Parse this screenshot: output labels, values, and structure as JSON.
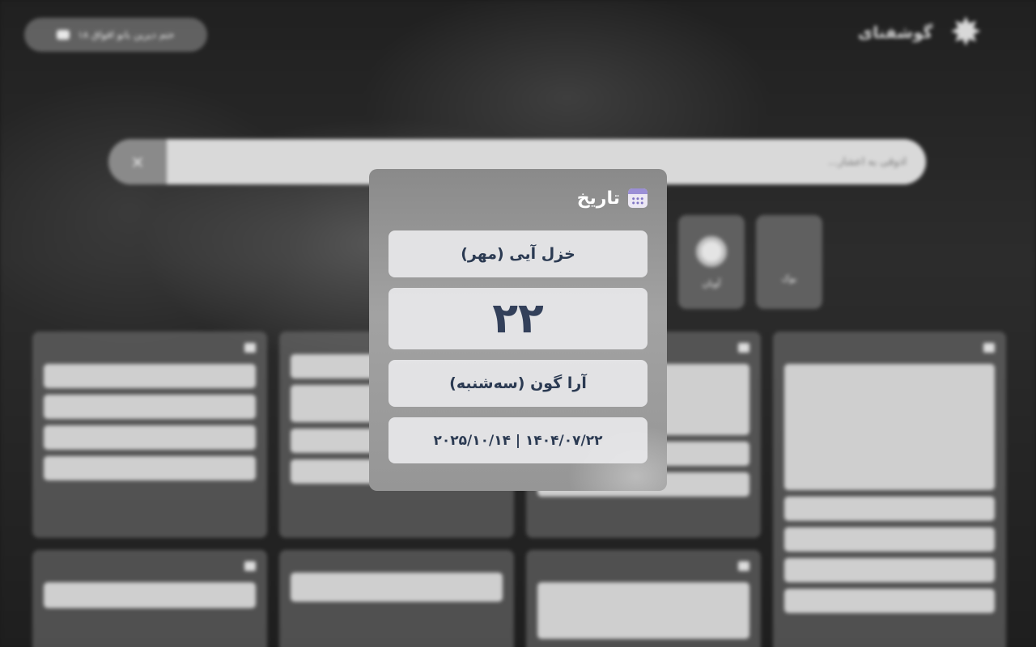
{
  "brand": {
    "name": "گوشفنای",
    "logo_icon": "mascot-logo"
  },
  "header": {
    "feedback_label": "ختم دیرین بانو اقواق ۱۸"
  },
  "search": {
    "placeholder": "آذوقی به اعشار...",
    "button_symbol": "×"
  },
  "quick_links": [
    {
      "label": "بوک"
    },
    {
      "label": "آویان"
    }
  ],
  "date_card": {
    "title": "تاریخ",
    "icon": "calendar-icon",
    "month": "خزل آیی (مهر)",
    "day": "۲۲",
    "weekday": "آرا گون (سه‌شنبه)",
    "dates": "۱۴۰۴/۰۷/۲۲ | ۲۰۲۵/۱۰/۱۴"
  },
  "colors": {
    "card_text": "#2b3a52",
    "card_title": "#ffffff",
    "calendar_accent": "#9b8fd6"
  }
}
